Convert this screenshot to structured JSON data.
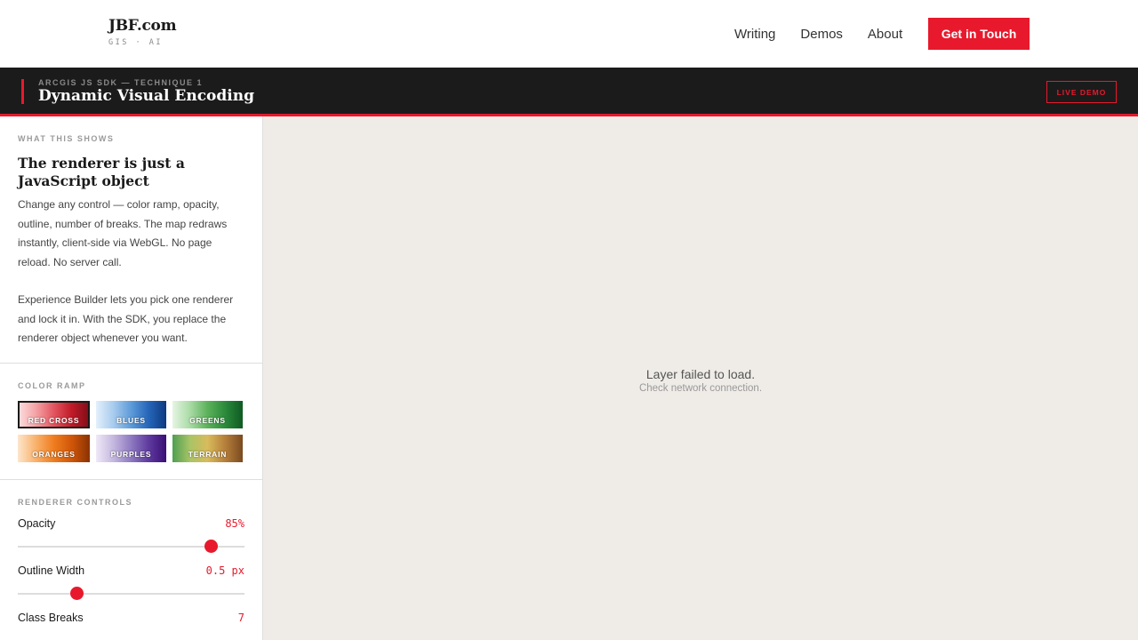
{
  "brand": {
    "name": "JBF.com",
    "tagline": "GIS · AI"
  },
  "nav": {
    "links": [
      "Writing",
      "Demos",
      "About"
    ],
    "cta": "Get in Touch"
  },
  "titlebar": {
    "kicker": "ARCGIS JS SDK — TECHNIQUE 1",
    "title": "Dynamic Visual Encoding",
    "badge": "LIVE DEMO"
  },
  "about": {
    "label": "WHAT THIS SHOWS",
    "heading": "The renderer is just a JavaScript object",
    "p1": "Change any control — color ramp, opacity, outline, number of breaks. The map redraws instantly, client-side via WebGL. No page reload. No server call.",
    "p2": "Experience Builder lets you pick one renderer and lock it in. With the SDK, you replace the renderer object whenever you want."
  },
  "ramps": {
    "label": "COLOR RAMP",
    "selected": "RED CROSS",
    "items": [
      {
        "label": "RED CROSS",
        "colors": [
          "#fde0e0",
          "#f4a3a6",
          "#e35560",
          "#c01a28",
          "#7e0d17"
        ]
      },
      {
        "label": "BLUES",
        "colors": [
          "#e3f0fb",
          "#a7cbed",
          "#5d9bd9",
          "#2565b8",
          "#0d3a80"
        ]
      },
      {
        "label": "GREENS",
        "colors": [
          "#e5f5e3",
          "#a9dba5",
          "#5cb25a",
          "#2b8a3b",
          "#0f5a22"
        ]
      },
      {
        "label": "ORANGES",
        "colors": [
          "#fde5cc",
          "#f9b26c",
          "#ef7d1f",
          "#cf5608",
          "#8a3203"
        ]
      },
      {
        "label": "PURPLES",
        "colors": [
          "#efe9f6",
          "#c4b7df",
          "#8e7ac0",
          "#5e3a9e",
          "#3a0f76"
        ]
      },
      {
        "label": "TERRAIN",
        "colors": [
          "#4f9f52",
          "#a9c466",
          "#d8bb5c",
          "#b67f3a",
          "#7a4a20"
        ]
      }
    ]
  },
  "controls": {
    "label": "RENDERER CONTROLS",
    "opacity": {
      "name": "Opacity",
      "display": "85%",
      "value": 0.85
    },
    "outline": {
      "name": "Outline Width",
      "display": "0.5 px",
      "value": 0.26
    },
    "breaks": {
      "name": "Class Breaks",
      "display": "7"
    }
  },
  "map": {
    "error": "Layer failed to load.",
    "hint": "Check network connection."
  },
  "colors": {
    "accent": "#e8192c",
    "dark": "#1b1b1b",
    "map_bg": "#efece8"
  }
}
